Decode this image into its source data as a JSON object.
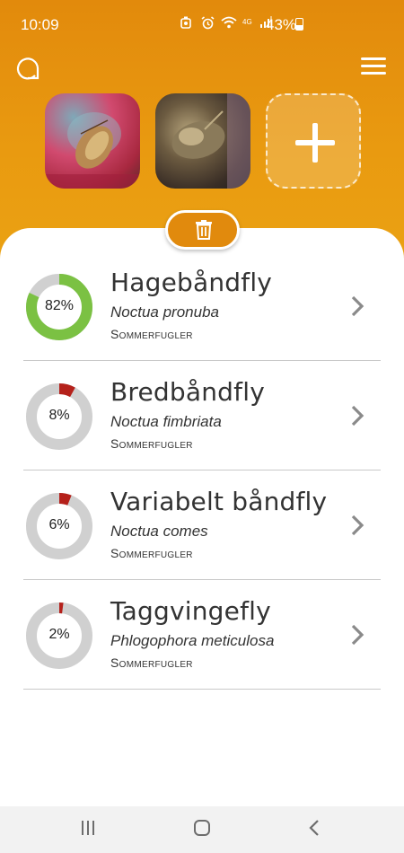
{
  "status_bar": {
    "time": "10:09",
    "network": "4G",
    "battery": "43%"
  },
  "header": {
    "logo_icon": "circle-logo-icon",
    "menu_icon": "hamburger-menu-icon",
    "photos": [
      {
        "alt": "moth-photo-1"
      },
      {
        "alt": "moth-photo-2"
      }
    ],
    "add_icon": "plus-icon",
    "delete_icon": "trash-icon",
    "accent_color": "#e28a0c"
  },
  "results": [
    {
      "percent": 82,
      "percent_label": "82%",
      "common_name": "Hagebåndfly",
      "latin_name": "Noctua pronuba",
      "category": "Sommerfugler",
      "color": "#7bc143"
    },
    {
      "percent": 8,
      "percent_label": "8%",
      "common_name": "Bredbåndfly",
      "latin_name": "Noctua fimbriata",
      "category": "Sommerfugler",
      "color": "#b5211b"
    },
    {
      "percent": 6,
      "percent_label": "6%",
      "common_name": "Variabelt båndfly",
      "latin_name": "Noctua comes",
      "category": "Sommerfugler",
      "color": "#b5211b"
    },
    {
      "percent": 2,
      "percent_label": "2%",
      "common_name": "Taggvingefly",
      "latin_name": "Phlogophora meticulosa",
      "category": "Sommerfugler",
      "color": "#b5211b"
    }
  ],
  "nav": {
    "recents_icon": "recents-icon",
    "home_icon": "home-icon",
    "back_icon": "back-icon"
  }
}
